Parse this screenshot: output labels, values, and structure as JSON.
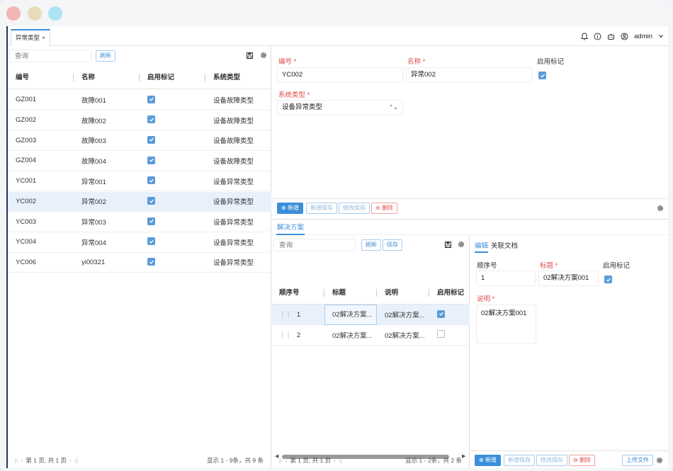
{
  "window": {
    "dots": [
      "#f5b4b4",
      "#e6ddb7",
      "#aee3f5"
    ]
  },
  "tab": {
    "label": "异常类型",
    "close": "×"
  },
  "header": {
    "user": "admin"
  },
  "left": {
    "search_placeholder": "查询",
    "refresh": "刷新",
    "columns": [
      "编号",
      "名称",
      "启用标记",
      "系统类型"
    ],
    "rows": [
      {
        "code": "GZ001",
        "name": "故障001",
        "enabled": true,
        "type": "设备故障类型"
      },
      {
        "code": "GZ002",
        "name": "故障002",
        "enabled": true,
        "type": "设备故障类型"
      },
      {
        "code": "GZ003",
        "name": "故障003",
        "enabled": true,
        "type": "设备故障类型"
      },
      {
        "code": "GZ004",
        "name": "故障004",
        "enabled": true,
        "type": "设备故障类型"
      },
      {
        "code": "YC001",
        "name": "异常001",
        "enabled": true,
        "type": "设备异常类型"
      },
      {
        "code": "YC002",
        "name": "异常002",
        "enabled": true,
        "type": "设备异常类型"
      },
      {
        "code": "YC003",
        "name": "异常003",
        "enabled": true,
        "type": "设备异常类型"
      },
      {
        "code": "YC004",
        "name": "异常004",
        "enabled": true,
        "type": "设备异常类型"
      },
      {
        "code": "YC006",
        "name": "yi00321",
        "enabled": true,
        "type": "设备异常类型"
      }
    ],
    "selected_row": 5,
    "pager_text": "第 1 页, 共 1 页",
    "total_text": "显示 1 - 9条，共 9 条"
  },
  "form": {
    "code_label": "编号 *",
    "code_value": "YC002",
    "name_label": "名称 *",
    "name_value": "异常002",
    "enabled_label": "启用标记",
    "enabled": true,
    "systype_label": "系统类型 *",
    "systype_value": "设备异常类型",
    "buttons": {
      "add": "新增",
      "add_save": "新增保存",
      "edit_save": "修改保存",
      "delete": "删除"
    }
  },
  "subtab": {
    "label": "解决方案"
  },
  "solutions": {
    "search_placeholder": "查询",
    "refresh": "刷新",
    "save": "保存",
    "columns": [
      "顺序号",
      "标题",
      "说明",
      "启用标记"
    ],
    "rows": [
      {
        "seq": "1",
        "title": "02解决方案...",
        "desc": "02解决方案...",
        "enabled": true
      },
      {
        "seq": "2",
        "title": "02解决方案...",
        "desc": "02解决方案...",
        "enabled": false
      }
    ],
    "pager_text": "第 1 页, 共 1 页",
    "total_text": "显示 1 - 2条，共 2 条"
  },
  "detail": {
    "tabs": [
      "编辑",
      "关联文档"
    ],
    "seq_label": "顺序号",
    "seq_value": "1",
    "title_label": "标题 *",
    "title_value": "02解决方案001",
    "enabled_label": "启用标记",
    "enabled": true,
    "desc_label": "说明 *",
    "desc_value": "02解决方案001",
    "buttons": {
      "add": "新增",
      "add_save": "新增保存",
      "edit_save": "修改保存",
      "delete": "删除",
      "upload": "上传文件"
    }
  },
  "colors": {
    "accent": "#3b8fd9",
    "sidebar": "#23345d",
    "required": "#e14c4c",
    "selected_row": "#e8f1fb"
  }
}
